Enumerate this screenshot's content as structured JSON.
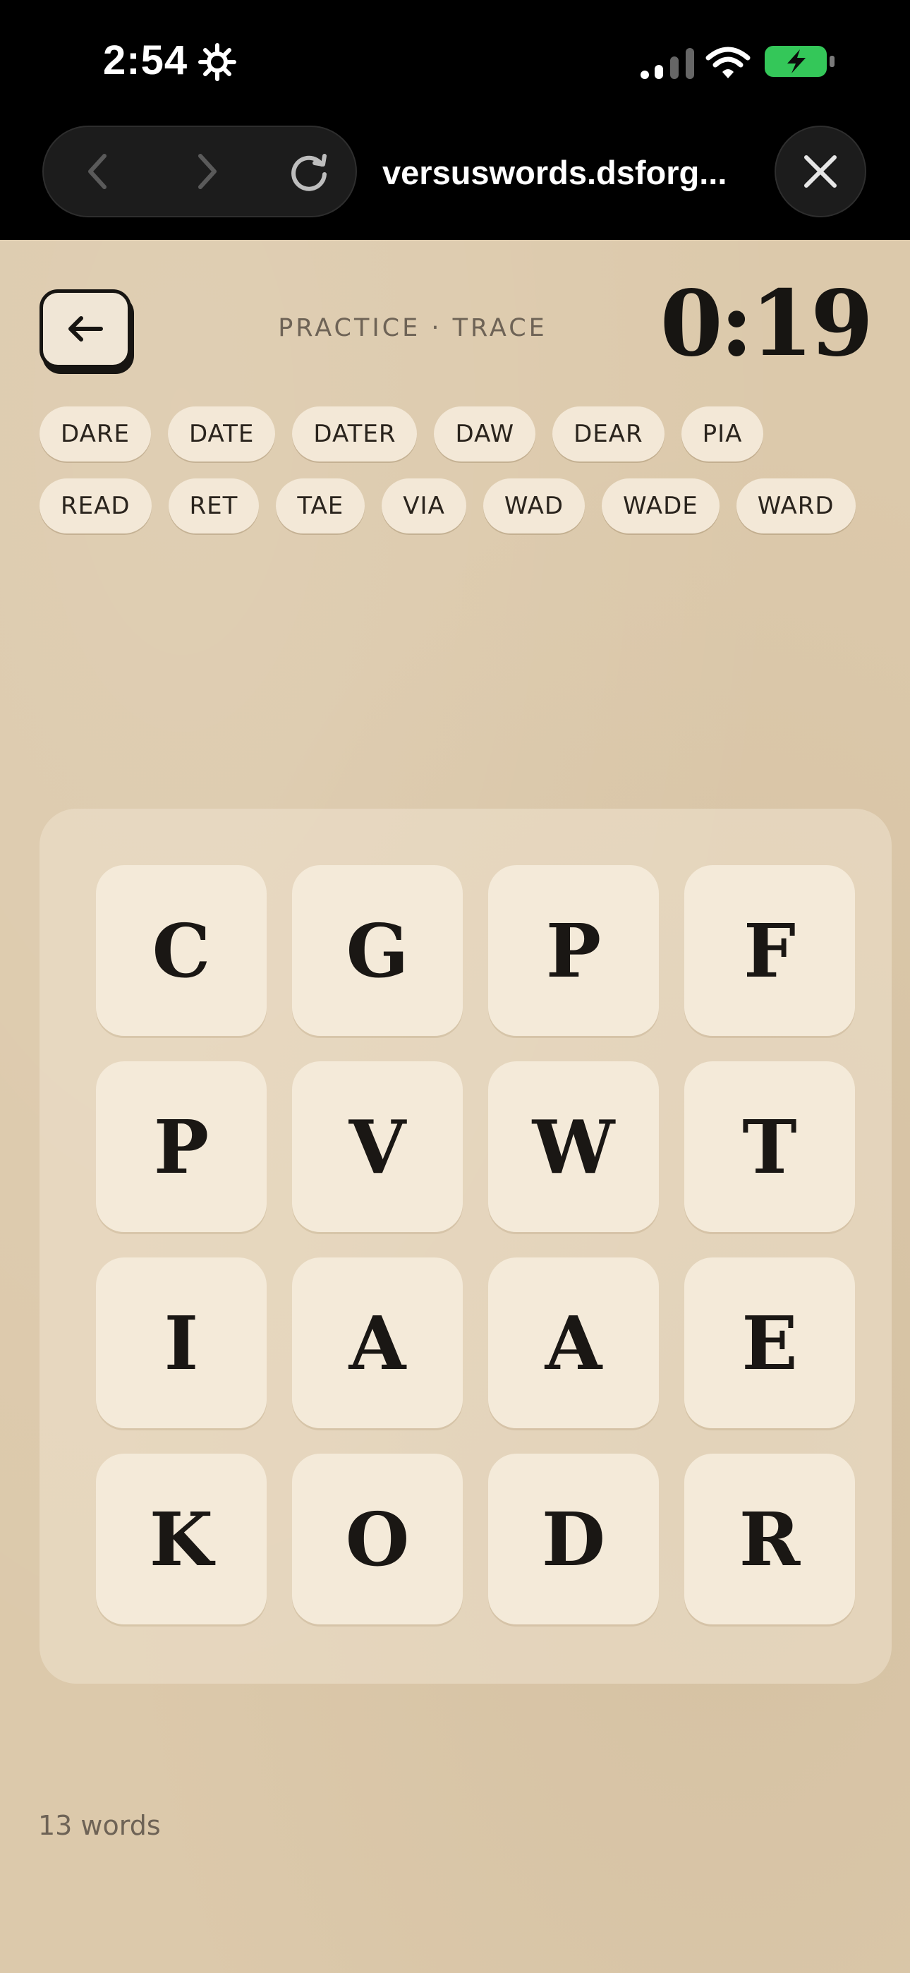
{
  "status_bar": {
    "time": "2:54"
  },
  "browser": {
    "url": "versuswords.dsforg...",
    "icons": [
      "back-chevron-icon",
      "forward-chevron-icon",
      "reload-icon",
      "close-icon"
    ]
  },
  "header": {
    "mode_title": "PRACTICE · TRACE",
    "timer": "0:19"
  },
  "found_words": [
    "DARE",
    "DATE",
    "DATER",
    "DAW",
    "DEAR",
    "PIA",
    "READ",
    "RET",
    "TAE",
    "VIA",
    "WAD",
    "WADE",
    "WARD"
  ],
  "board": {
    "rows": [
      [
        "C",
        "G",
        "P",
        "F"
      ],
      [
        "P",
        "V",
        "W",
        "T"
      ],
      [
        "I",
        "A",
        "A",
        "E"
      ],
      [
        "K",
        "O",
        "D",
        "R"
      ]
    ]
  },
  "footer": {
    "word_count": "13 words"
  },
  "colors": {
    "page_background": "#dcc9ab",
    "tile": "#f4ead9",
    "chip": "#f3e8d7",
    "ink": "#171512",
    "battery": "#34c759"
  }
}
